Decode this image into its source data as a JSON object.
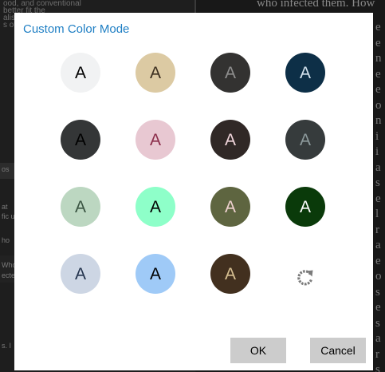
{
  "background": {
    "top_right_text": "who infected them. How",
    "top_left_text": "ood, and conventional\nbetter fit the\nalism\ns of",
    "right_edge_letters": [
      "e",
      "e",
      "n",
      "e",
      "e",
      "o",
      "n",
      "i",
      "i",
      "a",
      "s",
      "e",
      "l",
      "r",
      "a",
      "e",
      "o",
      "s",
      "e",
      "s",
      "a",
      "r",
      "s"
    ],
    "left_snippets": [
      "os",
      "at",
      "fic u",
      "ho",
      "Who",
      "ecte",
      "s. I"
    ]
  },
  "dialog": {
    "title": "Custom Color Mode",
    "swatches": [
      {
        "name": "swatch-white",
        "letter": "A",
        "bg": "#f1f2f3",
        "fg": "#000000"
      },
      {
        "name": "swatch-tan",
        "letter": "A",
        "bg": "#dccaa3",
        "fg": "#3b2e1f"
      },
      {
        "name": "swatch-charcoal",
        "letter": "A",
        "bg": "#333231",
        "fg": "#8f8f8f"
      },
      {
        "name": "swatch-navy",
        "letter": "A",
        "bg": "#0d2f47",
        "fg": "#d4e3ee"
      },
      {
        "name": "swatch-dark-gray",
        "letter": "A",
        "bg": "#343637",
        "fg": "#000000"
      },
      {
        "name": "swatch-pink",
        "letter": "A",
        "bg": "#e8c8d2",
        "fg": "#8b2d4a"
      },
      {
        "name": "swatch-dark-brown",
        "letter": "A",
        "bg": "#302826",
        "fg": "#f2d6dc"
      },
      {
        "name": "swatch-slate",
        "letter": "A",
        "bg": "#363b3c",
        "fg": "#8d9a9c"
      },
      {
        "name": "swatch-sage",
        "letter": "A",
        "bg": "#bcd7c1",
        "fg": "#3a5442"
      },
      {
        "name": "swatch-mint",
        "letter": "A",
        "bg": "#8effc9",
        "fg": "#000000"
      },
      {
        "name": "swatch-olive",
        "letter": "A",
        "bg": "#5e6540",
        "fg": "#f0d2d0"
      },
      {
        "name": "swatch-forest",
        "letter": "A",
        "bg": "#0a3a0a",
        "fg": "#ffffff"
      },
      {
        "name": "swatch-light-slate",
        "letter": "A",
        "bg": "#cdd6e4",
        "fg": "#24344e"
      },
      {
        "name": "swatch-sky",
        "letter": "A",
        "bg": "#9fcaf7",
        "fg": "#000000"
      },
      {
        "name": "swatch-coffee",
        "letter": "A",
        "bg": "#42301f",
        "fg": "#d8c193"
      }
    ],
    "reset_icon": "reset-icon",
    "ok_label": "OK",
    "cancel_label": "Cancel"
  }
}
